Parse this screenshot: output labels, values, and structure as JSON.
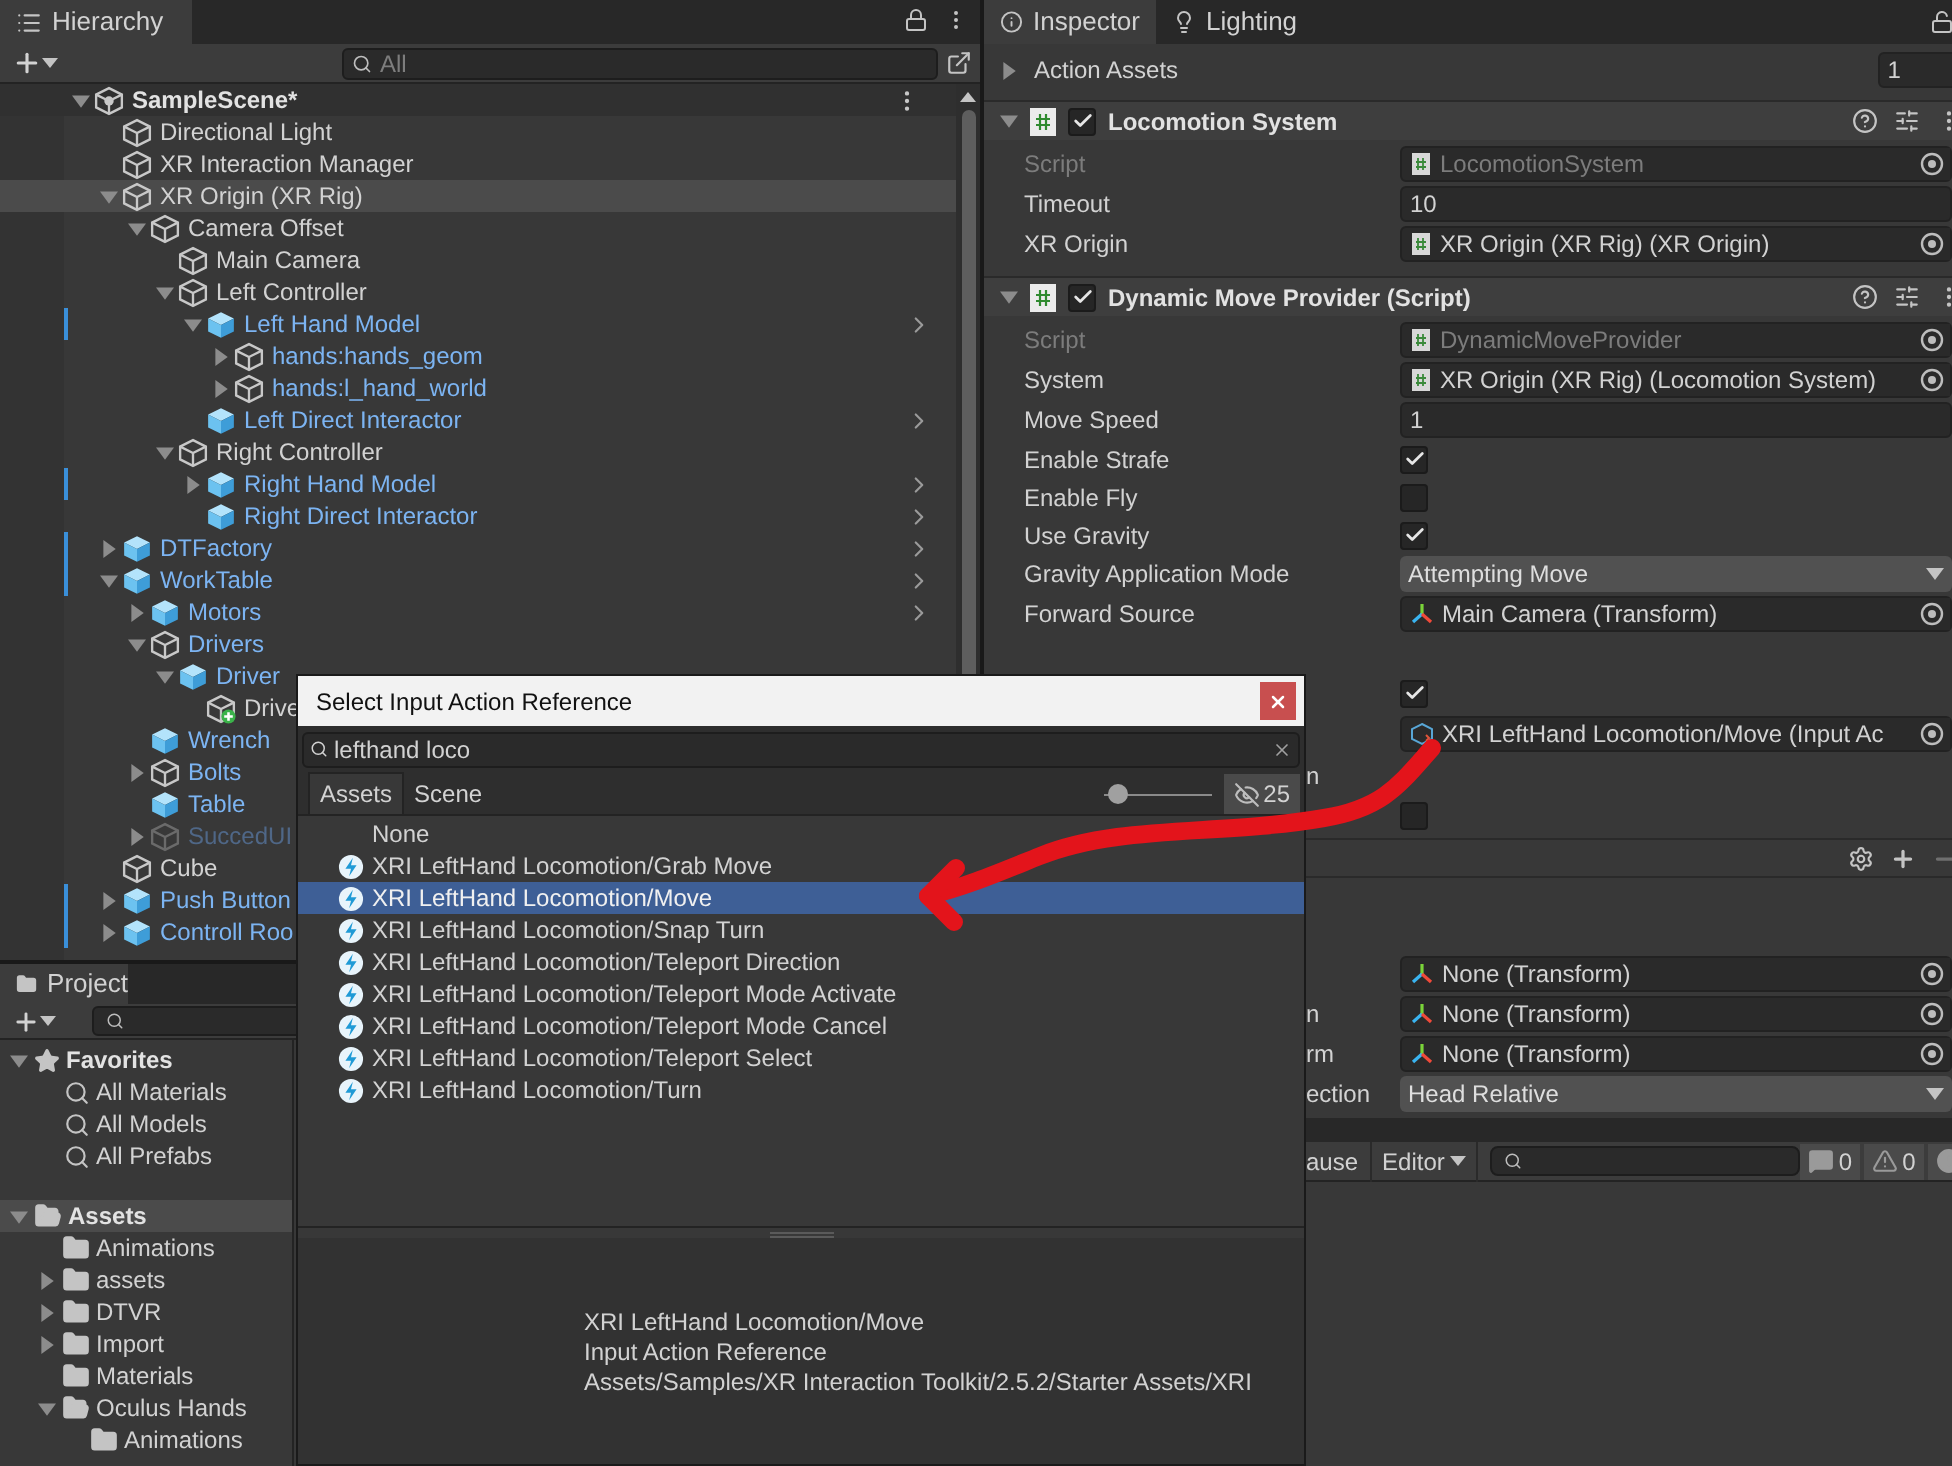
{
  "hierarchy": {
    "tab": "Hierarchy",
    "search": {
      "placeholder": "All"
    },
    "scene": {
      "label": "SampleScene*",
      "kind": "scene",
      "expanded": true,
      "selected": false,
      "overridden": false,
      "chevron": false,
      "children": [
        {
          "label": "Directional Light",
          "kind": "object",
          "selected": false,
          "overridden": false,
          "chevron": false
        },
        {
          "label": "XR Interaction Manager",
          "kind": "object",
          "selected": false,
          "overridden": false,
          "chevron": false
        },
        {
          "label": "XR Origin (XR Rig)",
          "kind": "object",
          "expanded": true,
          "selected": true,
          "overridden": false,
          "chevron": false,
          "children": [
            {
              "label": "Camera Offset",
              "kind": "object",
              "expanded": true,
              "selected": false,
              "overridden": false,
              "chevron": false,
              "children": [
                {
                  "label": "Main Camera",
                  "kind": "object",
                  "selected": false,
                  "overridden": false,
                  "chevron": false
                },
                {
                  "label": "Left Controller",
                  "kind": "object",
                  "expanded": true,
                  "selected": false,
                  "overridden": false,
                  "chevron": false,
                  "children": [
                    {
                      "label": "Left Hand Model",
                      "kind": "prefab",
                      "expanded": true,
                      "selected": false,
                      "overridden": true,
                      "chevron": true,
                      "children": [
                        {
                          "label": "hands:hands_geom",
                          "kind": "prefab_child",
                          "expanded": false,
                          "selected": false,
                          "overridden": false,
                          "chevron": false
                        },
                        {
                          "label": "hands:l_hand_world",
                          "kind": "prefab_child",
                          "expanded": false,
                          "selected": false,
                          "overridden": false,
                          "chevron": false
                        }
                      ]
                    },
                    {
                      "label": "Left Direct Interactor",
                      "kind": "prefab",
                      "selected": false,
                      "overridden": false,
                      "chevron": true
                    }
                  ]
                },
                {
                  "label": "Right Controller",
                  "kind": "object",
                  "expanded": true,
                  "selected": false,
                  "overridden": false,
                  "chevron": false,
                  "children": [
                    {
                      "label": "Right Hand Model",
                      "kind": "prefab",
                      "expanded": false,
                      "selected": false,
                      "overridden": true,
                      "chevron": true
                    },
                    {
                      "label": "Right Direct Interactor",
                      "kind": "prefab",
                      "selected": false,
                      "overridden": false,
                      "chevron": true
                    }
                  ]
                }
              ]
            }
          ]
        },
        {
          "label": "DTFactory",
          "kind": "prefab",
          "expanded": false,
          "selected": false,
          "overridden": true,
          "chevron": true
        },
        {
          "label": "WorkTable",
          "kind": "prefab",
          "expanded": true,
          "selected": false,
          "overridden": true,
          "chevron": true,
          "children": [
            {
              "label": "Motors",
              "kind": "prefab",
              "expanded": false,
              "selected": false,
              "overridden": false,
              "chevron": true
            },
            {
              "label": "Drivers",
              "kind": "prefab_child",
              "expanded": true,
              "selected": false,
              "overridden": false,
              "chevron": false,
              "children": [
                {
                  "label": "Driver",
                  "kind": "prefab",
                  "expanded": true,
                  "selected": false,
                  "overridden": false,
                  "chevron": false,
                  "children": [
                    {
                      "label": "Drive",
                      "kind": "added",
                      "selected": false,
                      "overridden": false,
                      "chevron": false
                    }
                  ]
                }
              ]
            },
            {
              "label": "Wrench",
              "kind": "prefab",
              "selected": false,
              "overridden": false,
              "chevron": false
            },
            {
              "label": "Bolts",
              "kind": "prefab_child",
              "expanded": false,
              "selected": false,
              "overridden": false,
              "chevron": false
            },
            {
              "label": "Table",
              "kind": "prefab",
              "selected": false,
              "overridden": false,
              "chevron": false
            },
            {
              "label": "SuccedUI",
              "kind": "inactive",
              "expanded": false,
              "selected": false,
              "overridden": false,
              "chevron": false
            }
          ]
        },
        {
          "label": "Cube",
          "kind": "object",
          "selected": false,
          "overridden": false,
          "chevron": false
        },
        {
          "label": "Push Button",
          "kind": "prefab",
          "expanded": false,
          "selected": false,
          "overridden": true,
          "chevron": false
        },
        {
          "label": "Controll Roo",
          "kind": "prefab",
          "expanded": false,
          "selected": false,
          "overridden": true,
          "chevron": false
        }
      ]
    }
  },
  "project": {
    "tab": "Project",
    "favorites": {
      "label": "Favorites",
      "expanded": true,
      "selected": false,
      "items": [
        {
          "label": "All Materials"
        },
        {
          "label": "All Models"
        },
        {
          "label": "All Prefabs"
        }
      ]
    },
    "assets": {
      "label": "Assets",
      "expanded": true,
      "selected": true,
      "children": [
        {
          "label": "Animations"
        },
        {
          "label": "assets",
          "expanded": false
        },
        {
          "label": "DTVR",
          "expanded": false
        },
        {
          "label": "Import",
          "expanded": false
        },
        {
          "label": "Materials"
        },
        {
          "label": "Oculus Hands",
          "expanded": true,
          "children": [
            {
              "label": "Animations"
            }
          ]
        }
      ]
    }
  },
  "inspector": {
    "tabs": [
      {
        "label": "Inspector",
        "selected": true
      },
      {
        "label": "Lighting",
        "selected": false
      }
    ],
    "action_assets": {
      "label": "Action Assets",
      "expanded": false,
      "value": "1"
    },
    "components": [
      {
        "title": "Locomotion System",
        "enabled": true,
        "expanded": true,
        "fields": [
          {
            "label": "Script",
            "kind": "object",
            "value": "LocomotionSystem",
            "disabled": true
          },
          {
            "label": "Timeout",
            "kind": "text",
            "value": "10",
            "disabled": false
          },
          {
            "label": "XR Origin",
            "kind": "object",
            "value": "XR Origin (XR Rig) (XR Origin)",
            "disabled": false
          }
        ]
      },
      {
        "title": "Dynamic Move Provider (Script)",
        "enabled": true,
        "expanded": true,
        "fields": [
          {
            "label": "Script",
            "kind": "object",
            "value": "DynamicMoveProvider",
            "disabled": true
          },
          {
            "label": "System",
            "kind": "object",
            "value": "XR Origin (XR Rig) (Locomotion System)",
            "disabled": false
          },
          {
            "label": "Move Speed",
            "kind": "text",
            "value": "1",
            "disabled": false
          },
          {
            "label": "Enable Strafe",
            "kind": "checkbox",
            "checked": true,
            "disabled": false
          },
          {
            "label": "Enable Fly",
            "kind": "checkbox",
            "checked": false,
            "disabled": false
          },
          {
            "label": "Use Gravity",
            "kind": "checkbox",
            "checked": true,
            "disabled": false
          },
          {
            "label": "Gravity Application Mode",
            "kind": "dropdown",
            "value": "Attempting Move",
            "disabled": false
          },
          {
            "label": "Forward Source",
            "kind": "transform",
            "value": "Main Camera (Transform)",
            "disabled": false
          }
        ]
      }
    ],
    "partly_covered_fields": [
      {
        "kind": "checkbox",
        "checked": true
      },
      {
        "kind": "action",
        "value": "XRI LeftHand Locomotion/Move (Input Ac"
      },
      {
        "kind": "label",
        "label": "n"
      },
      {
        "kind": "checkbox",
        "checked": false
      }
    ],
    "lower_fields": [
      {
        "kind": "transform",
        "value": "None (Transform)"
      },
      {
        "kind": "transform",
        "label": "n",
        "value": "None (Transform)"
      },
      {
        "kind": "transform",
        "label": "rm",
        "value": "None (Transform)"
      },
      {
        "kind": "dropdown",
        "label": "ection",
        "value": "Head Relative"
      }
    ]
  },
  "console": {
    "button": "ause",
    "mode": "Editor",
    "counts": [
      {
        "kind": "log",
        "value": "0"
      },
      {
        "kind": "warning",
        "value": "0"
      },
      {
        "kind": "error"
      }
    ]
  },
  "dialog": {
    "title": "Select Input Action Reference",
    "search": "lefthand loco",
    "tabs": [
      {
        "label": "Assets",
        "selected": true
      },
      {
        "label": "Scene",
        "selected": false
      }
    ],
    "zoom": {
      "level": 0.05
    },
    "hidden_count": "25",
    "items": [
      {
        "label": "None",
        "kind": "none",
        "selected": false
      },
      {
        "label": "XRI LeftHand Locomotion/Grab Move",
        "kind": "action",
        "selected": false
      },
      {
        "label": "XRI LeftHand Locomotion/Move",
        "kind": "action",
        "selected": true
      },
      {
        "label": "XRI LeftHand Locomotion/Snap Turn",
        "kind": "action",
        "selected": false
      },
      {
        "label": "XRI LeftHand Locomotion/Teleport Direction",
        "kind": "action",
        "selected": false
      },
      {
        "label": "XRI LeftHand Locomotion/Teleport Mode Activate",
        "kind": "action",
        "selected": false
      },
      {
        "label": "XRI LeftHand Locomotion/Teleport Mode Cancel",
        "kind": "action",
        "selected": false
      },
      {
        "label": "XRI LeftHand Locomotion/Teleport Select",
        "kind": "action",
        "selected": false
      },
      {
        "label": "XRI LeftHand Locomotion/Turn",
        "kind": "action",
        "selected": false
      }
    ],
    "preview": [
      "XRI LeftHand Locomotion/Move",
      "Input Action Reference",
      "Assets/Samples/XR Interaction Toolkit/2.5.2/Starter Assets/XRI"
    ]
  }
}
